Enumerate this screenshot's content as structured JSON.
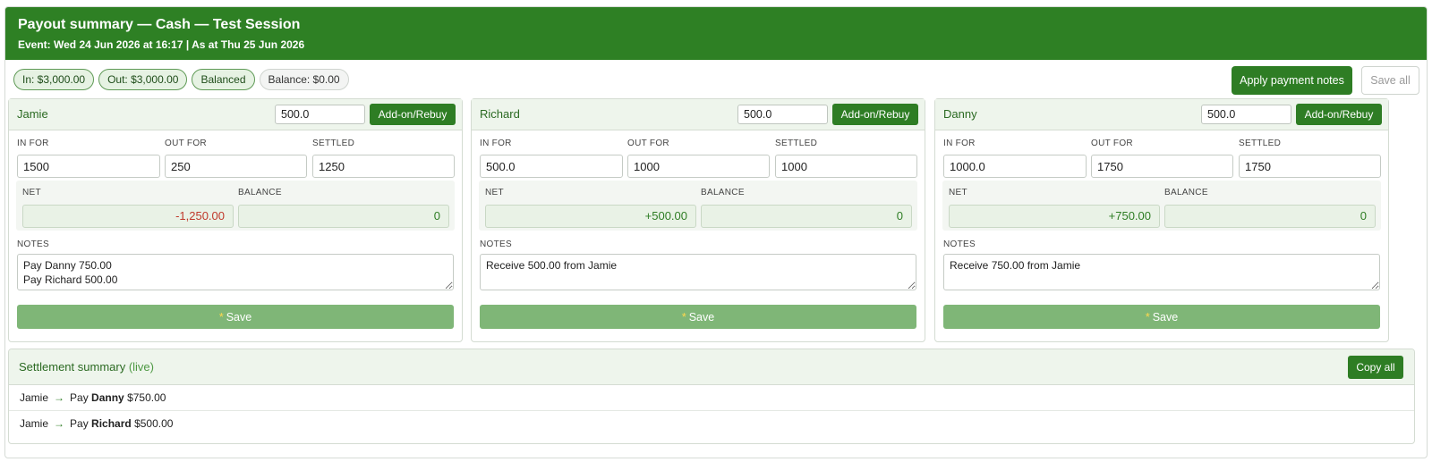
{
  "header": {
    "title": "Payout summary — Cash — Test Session",
    "subtitle": "Event: Wed 24 Jun 2026 at 16:17  |  As at Thu 25 Jun 2026"
  },
  "toolbar": {
    "pill_in": "In: $3,000.00",
    "pill_out": "Out: $3,000.00",
    "pill_balanced": "Balanced",
    "pill_balance": "Balance: $0.00",
    "apply_label": "Apply payment notes",
    "save_all_label": "Save all"
  },
  "labels": {
    "in_for": "IN FOR",
    "out_for": "OUT FOR",
    "settled": "SETTLED",
    "net": "NET",
    "balance": "BALANCE",
    "notes": "NOTES",
    "addon_button": "Add-on/Rebuy",
    "save_button": "Save",
    "save_star": "*"
  },
  "players": [
    {
      "name": "Jamie",
      "addon_value": "500.0",
      "in_for": "1500",
      "out_for": "250",
      "settled": "1250",
      "net": "-1,250.00",
      "balance": "0",
      "notes": "Pay Danny 750.00\nPay Richard 500.00"
    },
    {
      "name": "Richard",
      "addon_value": "500.0",
      "in_for": "500.0",
      "out_for": "1000",
      "settled": "1000",
      "net": "+500.00",
      "balance": "0",
      "notes": "Receive 500.00 from Jamie"
    },
    {
      "name": "Danny",
      "addon_value": "500.0",
      "in_for": "1000.0",
      "out_for": "1750",
      "settled": "1750",
      "net": "+750.00",
      "balance": "0",
      "notes": "Receive 750.00 from Jamie"
    }
  ],
  "summary": {
    "title": "Settlement summary",
    "live_tag": "(live)",
    "copy_label": "Copy all",
    "rows": [
      {
        "from": "Jamie",
        "arrow": "→",
        "action": "Pay",
        "to": "Danny",
        "amount": "$750.00"
      },
      {
        "from": "Jamie",
        "arrow": "→",
        "action": "Pay",
        "to": "Richard",
        "amount": "$500.00"
      }
    ]
  },
  "colors": {
    "brand_green": "#2e8024",
    "button_green": "#2e7d24",
    "save_button": "#7fb677",
    "negative": "#c0392b",
    "positive": "#2e7d24"
  }
}
